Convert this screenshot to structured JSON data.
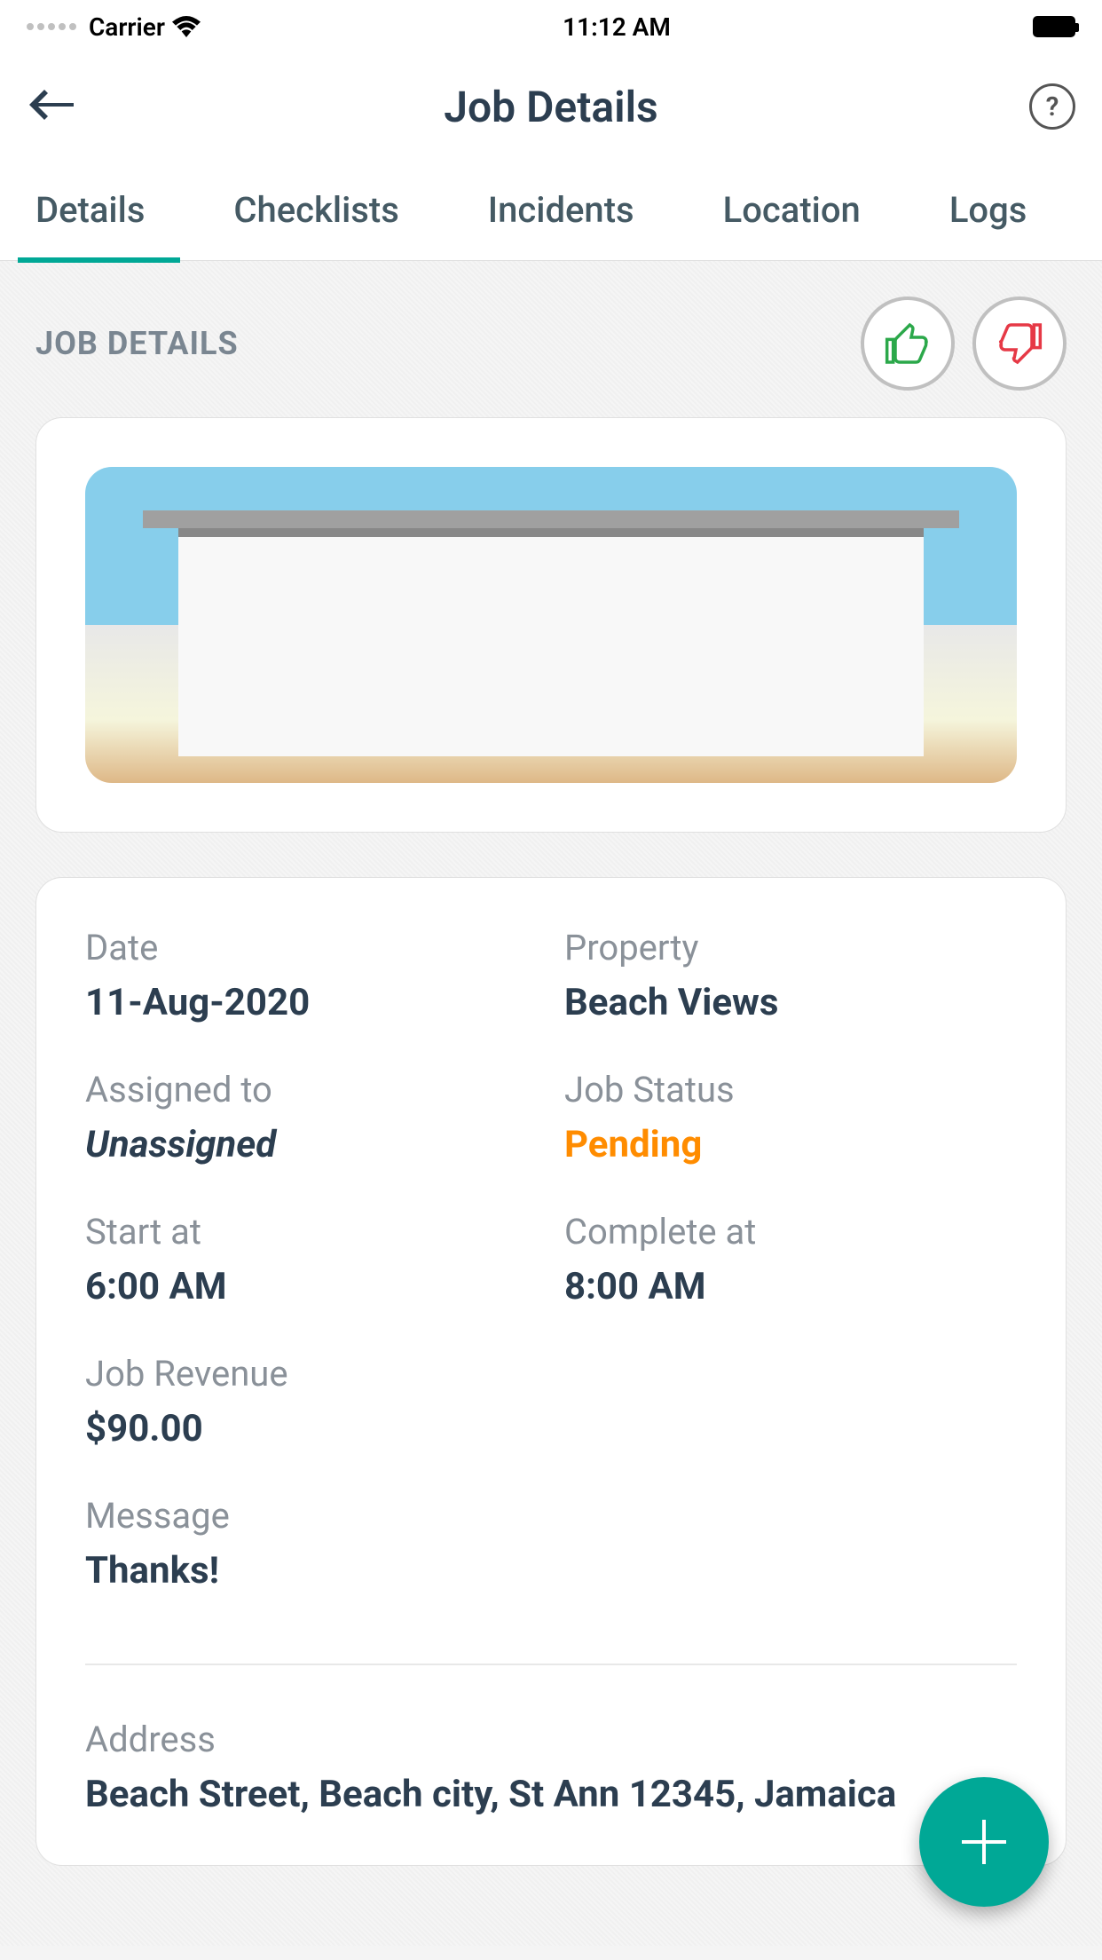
{
  "status_bar": {
    "carrier": "Carrier",
    "time": "11:12 AM"
  },
  "header": {
    "title": "Job Details",
    "help": "?"
  },
  "tabs": {
    "details": "Details",
    "checklists": "Checklists",
    "incidents": "Incidents",
    "location": "Location",
    "logs": "Logs"
  },
  "section": {
    "title": "JOB DETAILS"
  },
  "details": {
    "date_label": "Date",
    "date_value": "11-Aug-2020",
    "property_label": "Property",
    "property_value": "Beach Views",
    "assigned_label": "Assigned to",
    "assigned_value": "Unassigned",
    "status_label": "Job Status",
    "status_value": "Pending",
    "start_label": "Start at",
    "start_value": "6:00 AM",
    "complete_label": "Complete at",
    "complete_value": "8:00 AM",
    "revenue_label": "Job Revenue",
    "revenue_value": "$90.00",
    "message_label": "Message",
    "message_value": "Thanks!",
    "address_label": "Address",
    "address_value": "Beach Street, Beach city, St Ann 12345, Jamaica"
  }
}
